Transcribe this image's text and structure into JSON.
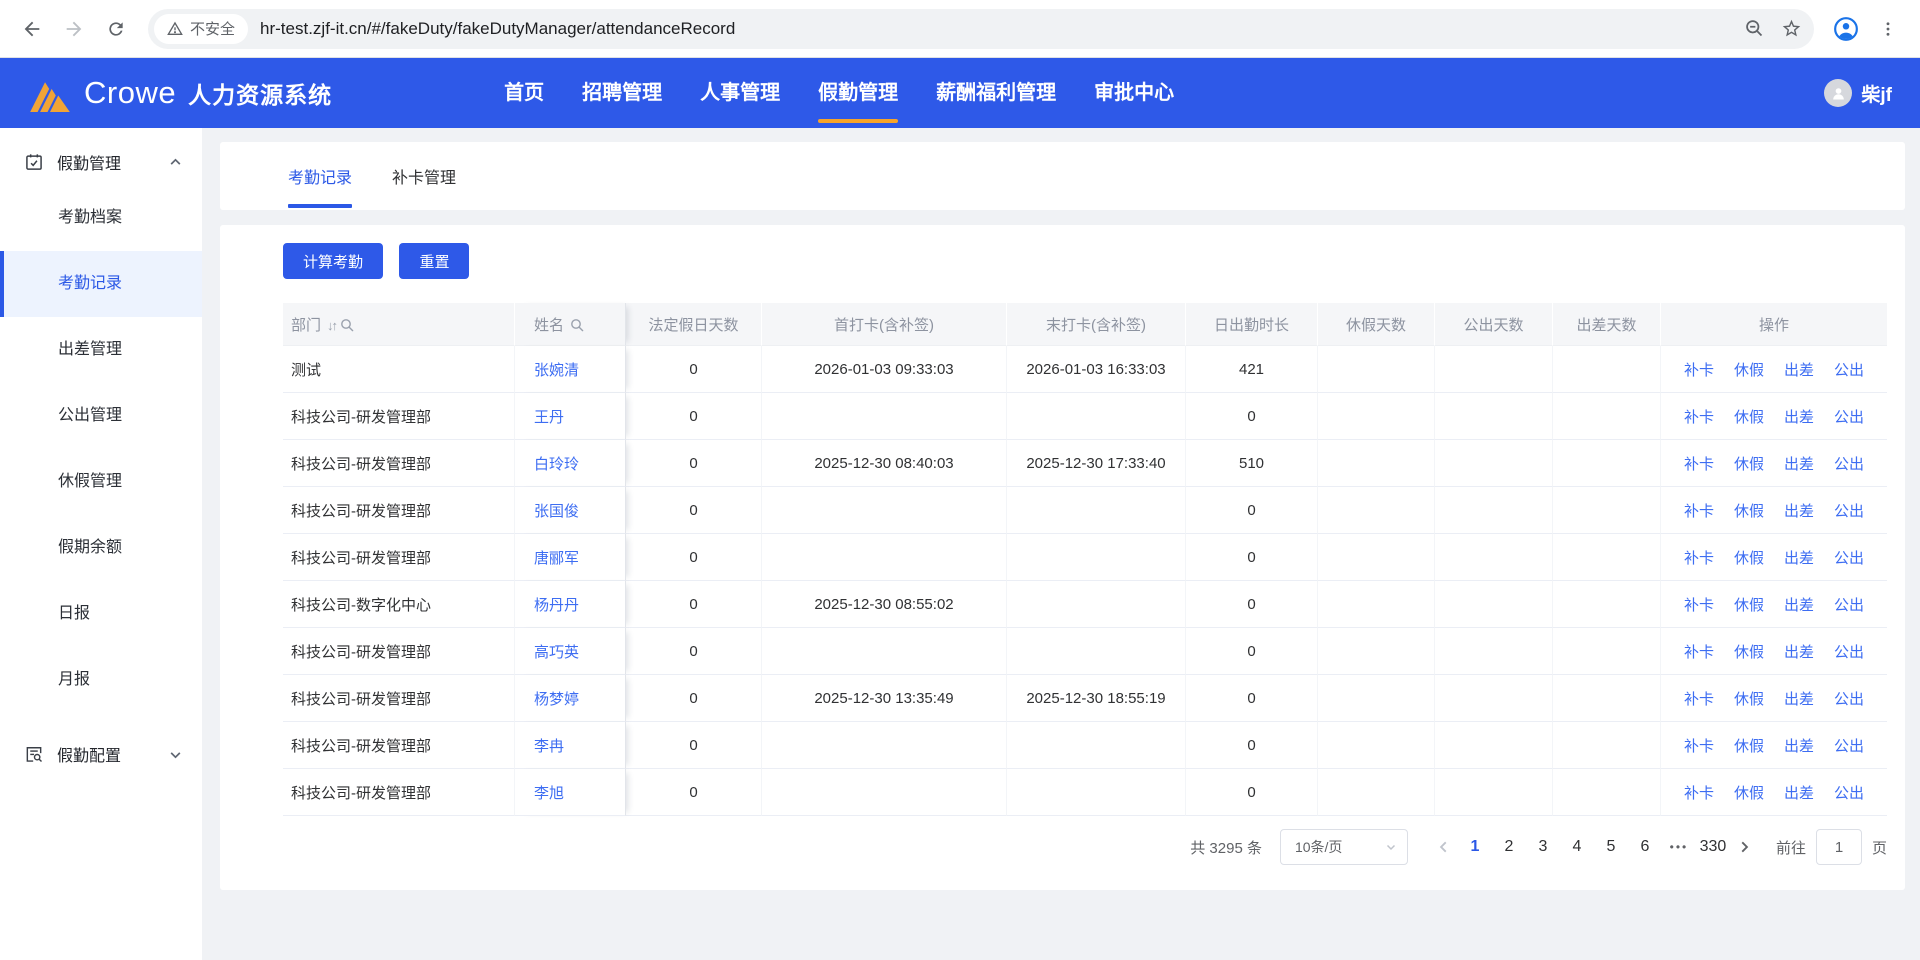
{
  "browser": {
    "security_label": "不安全",
    "url": "hr-test.zjf-it.cn/#/fakeDuty/fakeDutyManager/attendanceRecord"
  },
  "header": {
    "brand": "Crowe",
    "app_title": "人力资源系统",
    "nav": [
      {
        "label": "首页",
        "active": false
      },
      {
        "label": "招聘管理",
        "active": false
      },
      {
        "label": "人事管理",
        "active": false
      },
      {
        "label": "假勤管理",
        "active": true
      },
      {
        "label": "薪酬福利管理",
        "active": false
      },
      {
        "label": "审批中心",
        "active": false
      }
    ],
    "username": "柴jf"
  },
  "sidebar": {
    "group1": {
      "label": "假勤管理"
    },
    "items": [
      {
        "label": "考勤档案",
        "active": false
      },
      {
        "label": "考勤记录",
        "active": true
      },
      {
        "label": "出差管理",
        "active": false
      },
      {
        "label": "公出管理",
        "active": false
      },
      {
        "label": "休假管理",
        "active": false
      },
      {
        "label": "假期余额",
        "active": false
      },
      {
        "label": "日报",
        "active": false
      },
      {
        "label": "月报",
        "active": false
      }
    ],
    "group2": {
      "label": "假勤配置"
    }
  },
  "tabs": [
    {
      "label": "考勤记录",
      "active": true
    },
    {
      "label": "补卡管理",
      "active": false
    }
  ],
  "toolbar": {
    "calculate": "计算考勤",
    "reset": "重置"
  },
  "table": {
    "columns": {
      "dept": "部门",
      "name": "姓名",
      "statutory": "法定假日天数",
      "first": "首打卡(含补签)",
      "last": "末打卡(含补签)",
      "duration": "日出勤时长",
      "vacation": "休假天数",
      "public_out": "公出天数",
      "travel": "出差天数",
      "ops": "操作"
    },
    "actions": [
      "补卡",
      "休假",
      "出差",
      "公出"
    ],
    "rows": [
      {
        "dept": "测试",
        "name": "张婉清",
        "statutory": "0",
        "first": "2026-01-03 09:33:03",
        "last": "2026-01-03 16:33:03",
        "duration": "421",
        "vacation": "",
        "public_out": "",
        "travel": ""
      },
      {
        "dept": "科技公司-研发管理部",
        "name": "王丹",
        "statutory": "0",
        "first": "",
        "last": "",
        "duration": "0",
        "vacation": "",
        "public_out": "",
        "travel": ""
      },
      {
        "dept": "科技公司-研发管理部",
        "name": "白玲玲",
        "statutory": "0",
        "first": "2025-12-30 08:40:03",
        "last": "2025-12-30 17:33:40",
        "duration": "510",
        "vacation": "",
        "public_out": "",
        "travel": ""
      },
      {
        "dept": "科技公司-研发管理部",
        "name": "张国俊",
        "statutory": "0",
        "first": "",
        "last": "",
        "duration": "0",
        "vacation": "",
        "public_out": "",
        "travel": ""
      },
      {
        "dept": "科技公司-研发管理部",
        "name": "唐郦军",
        "statutory": "0",
        "first": "",
        "last": "",
        "duration": "0",
        "vacation": "",
        "public_out": "",
        "travel": ""
      },
      {
        "dept": "科技公司-数字化中心",
        "name": "杨丹丹",
        "statutory": "0",
        "first": "2025-12-30 08:55:02",
        "last": "",
        "duration": "0",
        "vacation": "",
        "public_out": "",
        "travel": ""
      },
      {
        "dept": "科技公司-研发管理部",
        "name": "高巧英",
        "statutory": "0",
        "first": "",
        "last": "",
        "duration": "0",
        "vacation": "",
        "public_out": "",
        "travel": ""
      },
      {
        "dept": "科技公司-研发管理部",
        "name": "杨梦婷",
        "statutory": "0",
        "first": "2025-12-30 13:35:49",
        "last": "2025-12-30 18:55:19",
        "duration": "0",
        "vacation": "",
        "public_out": "",
        "travel": ""
      },
      {
        "dept": "科技公司-研发管理部",
        "name": "李冉",
        "statutory": "0",
        "first": "",
        "last": "",
        "duration": "0",
        "vacation": "",
        "public_out": "",
        "travel": ""
      },
      {
        "dept": "科技公司-研发管理部",
        "name": "李旭",
        "statutory": "0",
        "first": "",
        "last": "",
        "duration": "0",
        "vacation": "",
        "public_out": "",
        "travel": ""
      }
    ]
  },
  "pagination": {
    "total": "共 3295 条",
    "page_size": "10条/页",
    "pages": [
      {
        "label": "1",
        "active": true
      },
      {
        "label": "2",
        "active": false
      },
      {
        "label": "3",
        "active": false
      },
      {
        "label": "4",
        "active": false
      },
      {
        "label": "5",
        "active": false
      },
      {
        "label": "6",
        "active": false
      }
    ],
    "more": "•••",
    "last_page": "330",
    "goto_label": "前往",
    "goto_value": "1",
    "unit": "页"
  }
}
